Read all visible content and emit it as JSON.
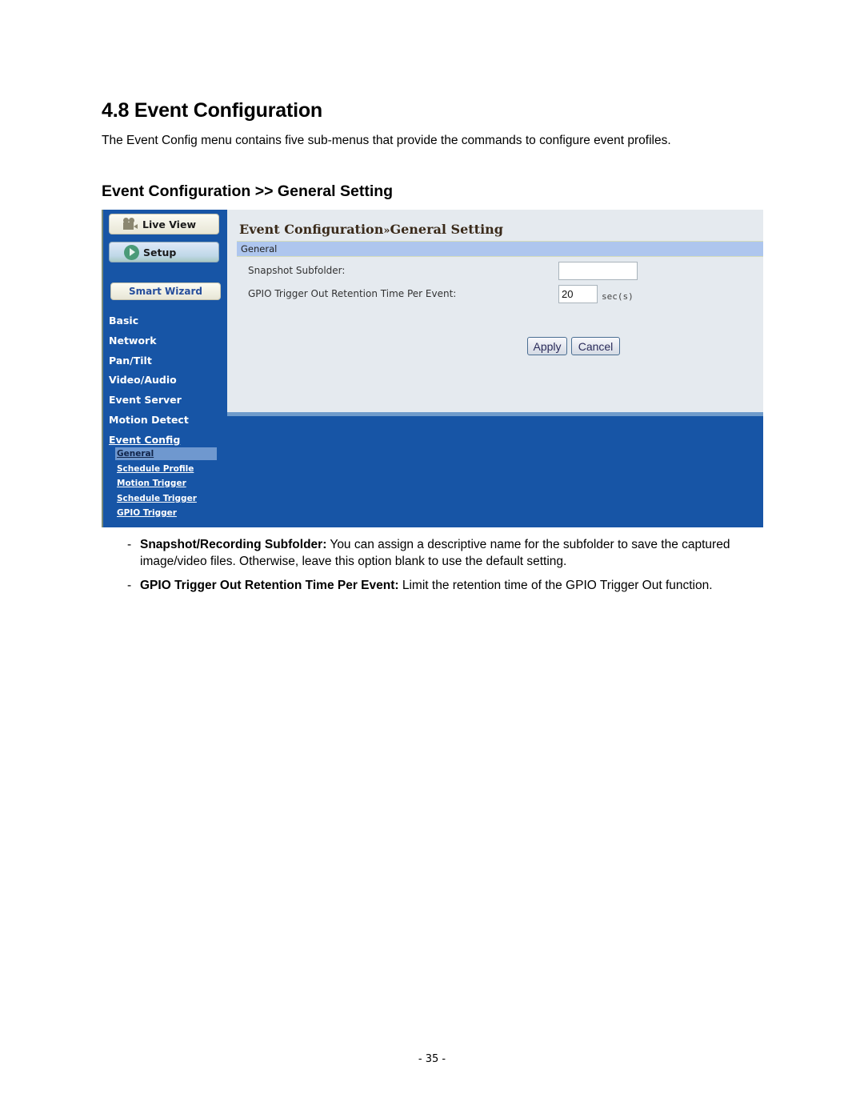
{
  "document": {
    "heading": "4.8  Event Configuration",
    "intro": "The Event Config menu contains five sub-menus that provide the commands to configure event profiles.",
    "subheading": "Event Configuration >> General Setting",
    "notes": [
      {
        "bullet": "-",
        "term": "Snapshot/Recording Subfolder:",
        "text": " You can assign a descriptive name for the subfolder to save the captured image/video files. Otherwise, leave this option blank to use the default setting."
      },
      {
        "bullet": "-",
        "term": "GPIO Trigger Out Retention Time Per Event:",
        "text": " Limit the retention time of the GPIO Trigger Out function."
      }
    ],
    "page_number": "- 35 -"
  },
  "screenshot": {
    "colors": {
      "sidebar_bg": "#1755a6",
      "content_bg": "#e5eaef",
      "section_bar": "#aec6ee",
      "active_submenu": "#6f98cf"
    },
    "sidebar": {
      "live_view": {
        "label": "Live View",
        "icon": "video-camera-icon"
      },
      "setup": {
        "label": "Setup",
        "icon": "setup-arrow-icon"
      },
      "smart_wizard": "Smart Wizard",
      "menu": [
        "Basic",
        "Network",
        "Pan/Tilt",
        "Video/Audio",
        "Event Server",
        "Motion Detect",
        "Event Config"
      ],
      "submenu": [
        "General",
        "Schedule Profile",
        "Motion Trigger",
        "Schedule Trigger",
        "GPIO Trigger"
      ],
      "active_submenu": "General"
    },
    "content": {
      "title_left": "Event Configuration",
      "title_sep": "»",
      "title_right": "General Setting",
      "section": "General",
      "fields": [
        {
          "label": "Snapshot Subfolder:",
          "value": ""
        },
        {
          "label": "GPIO Trigger Out Retention Time Per Event:",
          "value": "20",
          "unit": "sec(s)"
        }
      ],
      "apply_label": "Apply",
      "cancel_label": "Cancel"
    }
  }
}
